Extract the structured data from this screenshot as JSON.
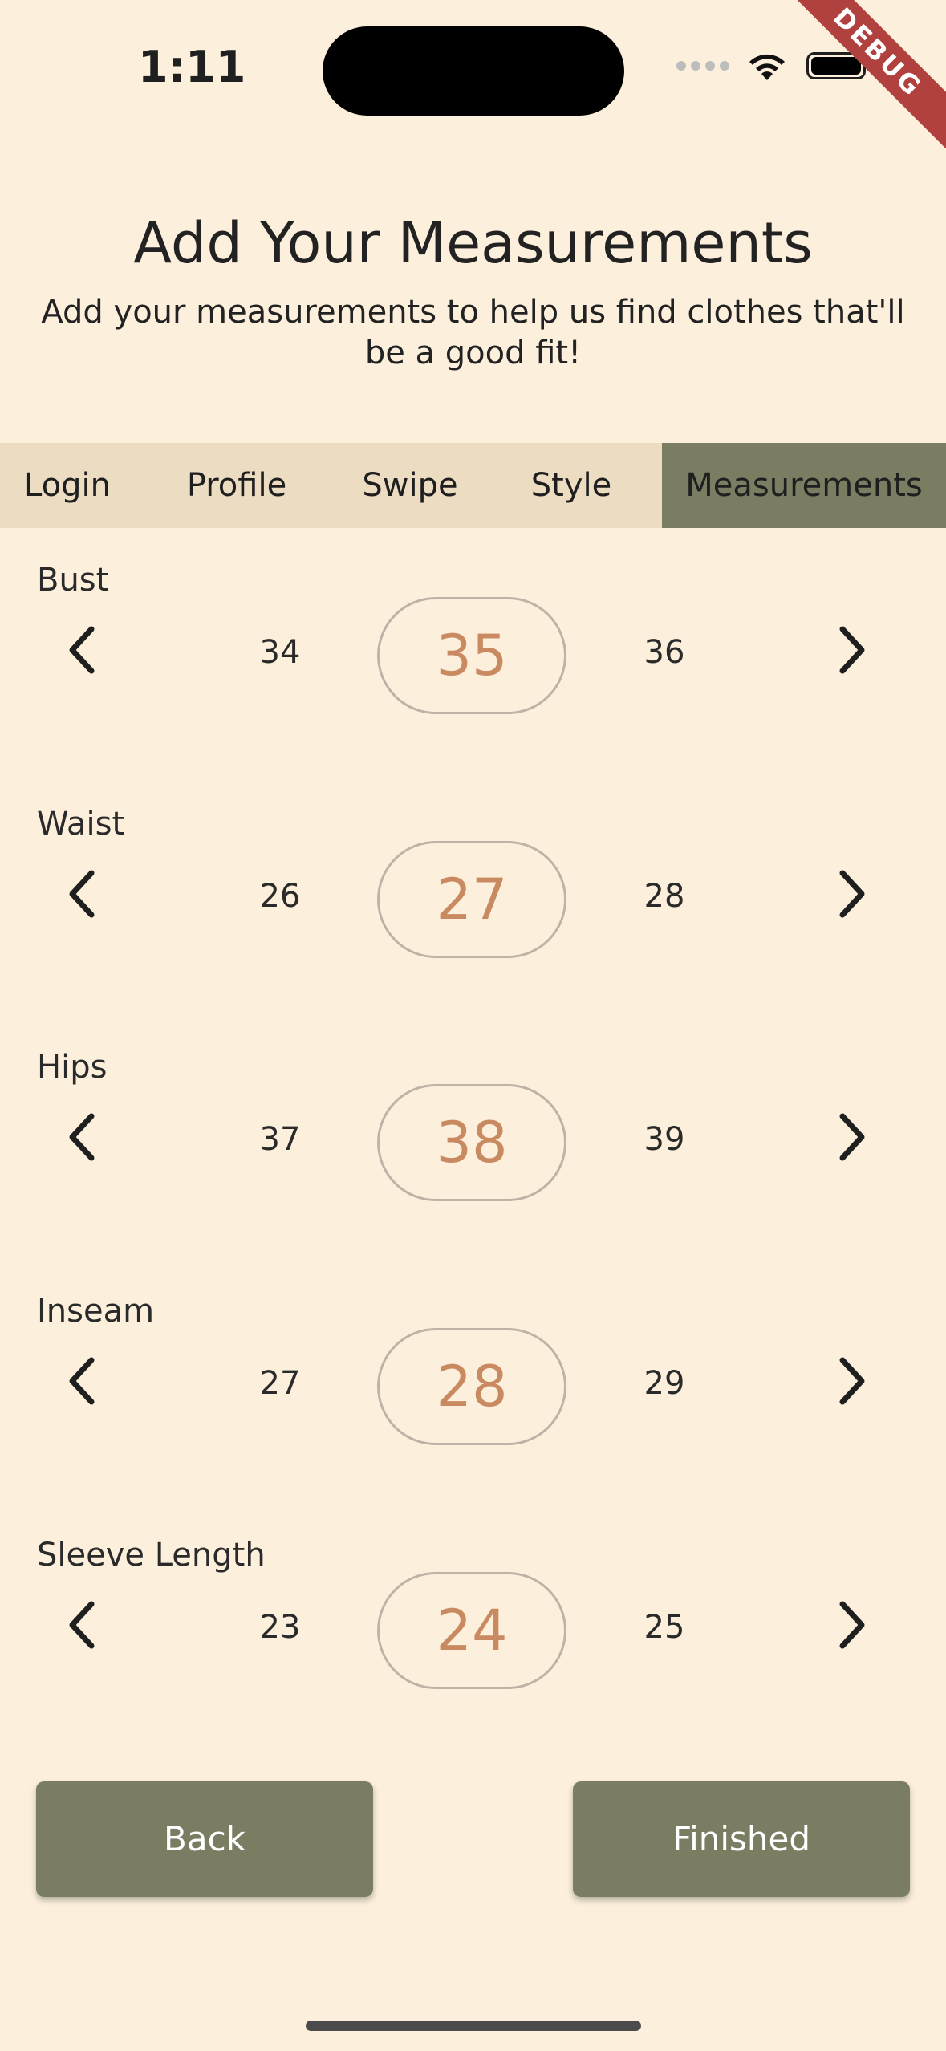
{
  "status_bar": {
    "time": "1:11"
  },
  "debug_banner": "DEBUG",
  "header": {
    "title": "Add Your Measurements",
    "subtitle": "Add your measurements to help us find clothes that'll be a good fit!"
  },
  "tabs": [
    {
      "label": "Login",
      "active": false
    },
    {
      "label": "Profile",
      "active": false
    },
    {
      "label": "Swipe",
      "active": false
    },
    {
      "label": "Style",
      "active": false
    },
    {
      "label": "Measurements",
      "active": true
    }
  ],
  "measurements": [
    {
      "label": "Bust",
      "prev": "34",
      "value": "35",
      "next": "36"
    },
    {
      "label": "Waist",
      "prev": "26",
      "value": "27",
      "next": "28"
    },
    {
      "label": "Hips",
      "prev": "37",
      "value": "38",
      "next": "39"
    },
    {
      "label": "Inseam",
      "prev": "27",
      "value": "28",
      "next": "29"
    },
    {
      "label": "Sleeve Length",
      "prev": "23",
      "value": "24",
      "next": "25"
    }
  ],
  "buttons": {
    "back": "Back",
    "finished": "Finished"
  },
  "colors": {
    "background": "#fcf0dc",
    "tab_bar": "#ebdcc2",
    "accent_olive": "#7b7d63",
    "selected_value": "#c98a62",
    "debug_ribbon": "#b0413e"
  }
}
